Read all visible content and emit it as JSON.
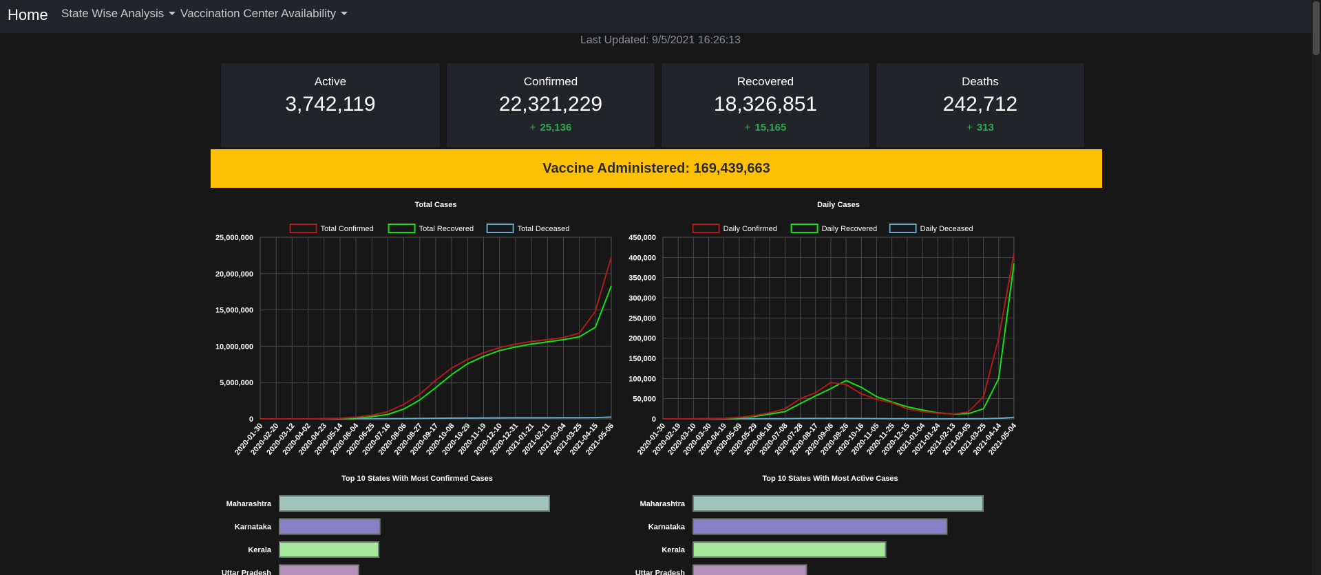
{
  "nav": {
    "home": "Home",
    "state_wise": "State Wise Analysis",
    "vaccination": "Vaccination Center Availability"
  },
  "last_updated": "Last Updated: 9/5/2021 16:26:13",
  "cards": {
    "active": {
      "label": "Active",
      "value": "3,742,119"
    },
    "confirmed": {
      "label": "Confirmed",
      "value": "22,321,229",
      "delta": "25,136"
    },
    "recovered": {
      "label": "Recovered",
      "value": "18,326,851",
      "delta": "15,165"
    },
    "deaths": {
      "label": "Deaths",
      "value": "242,712",
      "delta": "313"
    }
  },
  "delta_plus": "+",
  "vaccine_banner": "Vaccine Administered: 169,439,663",
  "colors": {
    "confirmed": "#b01b1b",
    "recovered": "#14e014",
    "deceased": "#66a9c8",
    "banner": "#ffc107"
  },
  "chart_data": [
    {
      "type": "line",
      "title": "Total Cases",
      "ylim": [
        0,
        25000000
      ],
      "yticks": [
        "25,000,000",
        "20,000,000",
        "15,000,000",
        "10,000,000",
        "5,000,000",
        "0"
      ],
      "categories": [
        "2020-01-30",
        "2020-02-20",
        "2020-03-12",
        "2020-04-02",
        "2020-04-23",
        "2020-05-14",
        "2020-06-04",
        "2020-06-25",
        "2020-07-16",
        "2020-08-06",
        "2020-08-27",
        "2020-09-17",
        "2020-10-08",
        "2020-10-29",
        "2020-11-19",
        "2020-12-10",
        "2020-12-31",
        "2021-01-21",
        "2021-02-11",
        "2021-03-04",
        "2021-03-25",
        "2021-04-15",
        "2021-05-06"
      ],
      "legend": "top",
      "grid": true,
      "series": [
        {
          "name": "Total Confirmed",
          "color": "#b01b1b",
          "values": [
            0,
            0,
            0,
            2500,
            25000,
            90000,
            230000,
            500000,
            1000000,
            2000000,
            3400000,
            5300000,
            7000000,
            8200000,
            9100000,
            9800000,
            10300000,
            10650000,
            10900000,
            11200000,
            11800000,
            14800000,
            22300000
          ]
        },
        {
          "name": "Total Recovered",
          "color": "#14e014",
          "values": [
            0,
            0,
            0,
            300,
            5500,
            40000,
            130000,
            300000,
            620000,
            1350000,
            2600000,
            4300000,
            6100000,
            7600000,
            8600000,
            9400000,
            9900000,
            10300000,
            10600000,
            10900000,
            11300000,
            12600000,
            18300000
          ]
        },
        {
          "name": "Total Deceased",
          "color": "#66a9c8",
          "values": [
            0,
            0,
            0,
            70,
            800,
            2800,
            7000,
            15000,
            26000,
            41000,
            61000,
            86000,
            106000,
            121000,
            133000,
            141000,
            149000,
            153000,
            155000,
            158000,
            161000,
            176000,
            242700
          ]
        }
      ]
    },
    {
      "type": "line",
      "title": "Daily Cases",
      "ylim": [
        0,
        450000
      ],
      "yticks": [
        "450,000",
        "400,000",
        "350,000",
        "300,000",
        "250,000",
        "200,000",
        "150,000",
        "100,000",
        "50,000",
        "0"
      ],
      "categories": [
        "2020-01-30",
        "2020-02-19",
        "2020-03-10",
        "2020-03-30",
        "2020-04-19",
        "2020-05-09",
        "2020-05-29",
        "2020-06-18",
        "2020-07-08",
        "2020-07-28",
        "2020-08-17",
        "2020-09-06",
        "2020-09-26",
        "2020-10-16",
        "2020-11-05",
        "2020-11-25",
        "2020-12-15",
        "2021-01-04",
        "2021-01-24",
        "2021-02-13",
        "2021-03-05",
        "2021-03-25",
        "2021-04-14",
        "2021-05-04"
      ],
      "legend": "top",
      "grid": true,
      "series": [
        {
          "name": "Daily Confirmed",
          "color": "#b01b1b",
          "values": [
            0,
            0,
            100,
            600,
            1500,
            3500,
            8000,
            15000,
            25000,
            50000,
            65000,
            90000,
            85000,
            62000,
            48000,
            40000,
            25000,
            18000,
            14000,
            12000,
            17000,
            55000,
            200000,
            410000
          ]
        },
        {
          "name": "Daily Recovered",
          "color": "#14e014",
          "values": [
            0,
            0,
            10,
            200,
            700,
            2500,
            6000,
            12000,
            18000,
            38000,
            57000,
            75000,
            95000,
            78000,
            55000,
            42000,
            30000,
            22000,
            15000,
            12000,
            13000,
            25000,
            100000,
            385000
          ]
        },
        {
          "name": "Daily Deceased",
          "color": "#66a9c8",
          "values": [
            0,
            0,
            0,
            20,
            50,
            110,
            250,
            400,
            550,
            800,
            950,
            1100,
            1050,
            900,
            600,
            450,
            350,
            200,
            130,
            100,
            120,
            300,
            1200,
            4000
          ]
        }
      ]
    },
    {
      "type": "bar",
      "title": "Top 10 States With Most Confirmed Cases",
      "categories": [
        "Maharashtra",
        "Karnataka",
        "Kerala",
        "Uttar Pradesh"
      ],
      "values": [
        4950000,
        1840000,
        1820000,
        1450000
      ],
      "colors": [
        "#9fc5bd",
        "#8a80c8",
        "#a4e99b",
        "#b692ba"
      ]
    },
    {
      "type": "bar",
      "title": "Top 10 States With Most Active Cases",
      "categories": [
        "Maharashtra",
        "Karnataka",
        "Kerala",
        "Uttar Pradesh"
      ],
      "values": [
        640000,
        560000,
        425000,
        250000
      ],
      "colors": [
        "#9fc5bd",
        "#8a80c8",
        "#a4e99b",
        "#b692ba"
      ]
    }
  ]
}
